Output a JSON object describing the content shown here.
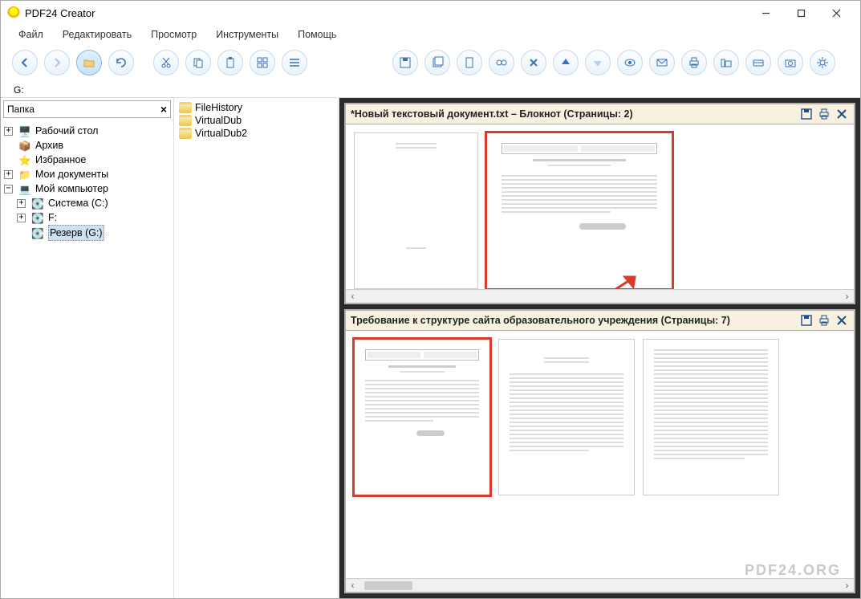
{
  "title": "PDF24 Creator",
  "menu": {
    "file": "Файл",
    "edit": "Редактировать",
    "view": "Просмотр",
    "tools": "Инструменты",
    "help": "Помощь"
  },
  "location": "G:",
  "folder_label": "Папка",
  "tree": [
    {
      "exp": "+",
      "icon": "desktop",
      "label": "Рабочий стол",
      "ind": 0
    },
    {
      "exp": "",
      "icon": "archive",
      "label": "Архив",
      "ind": 0
    },
    {
      "exp": "",
      "icon": "favorites",
      "label": "Избранное",
      "ind": 0
    },
    {
      "exp": "+",
      "icon": "docs",
      "label": "Мои документы",
      "ind": 0
    },
    {
      "exp": "-",
      "icon": "computer",
      "label": "Мой компьютер",
      "ind": 0
    },
    {
      "exp": "+",
      "icon": "drive",
      "label": "Система (C:)",
      "ind": 1
    },
    {
      "exp": "+",
      "icon": "drive",
      "label": "F:",
      "ind": 1
    },
    {
      "exp": "",
      "icon": "drive",
      "label": "Резерв (G:)",
      "ind": 1,
      "selected": true
    }
  ],
  "files": [
    "FileHistory",
    "VirtualDub",
    "VirtualDub2"
  ],
  "docs": {
    "top": {
      "title": "*Новый текстовый документ.txt – Блокнот (Страницы: 2)"
    },
    "bot": {
      "title": "Требование к структуре сайта образовательного учреждения (Страницы: 7)"
    }
  },
  "watermark": "PDF24.ORG"
}
